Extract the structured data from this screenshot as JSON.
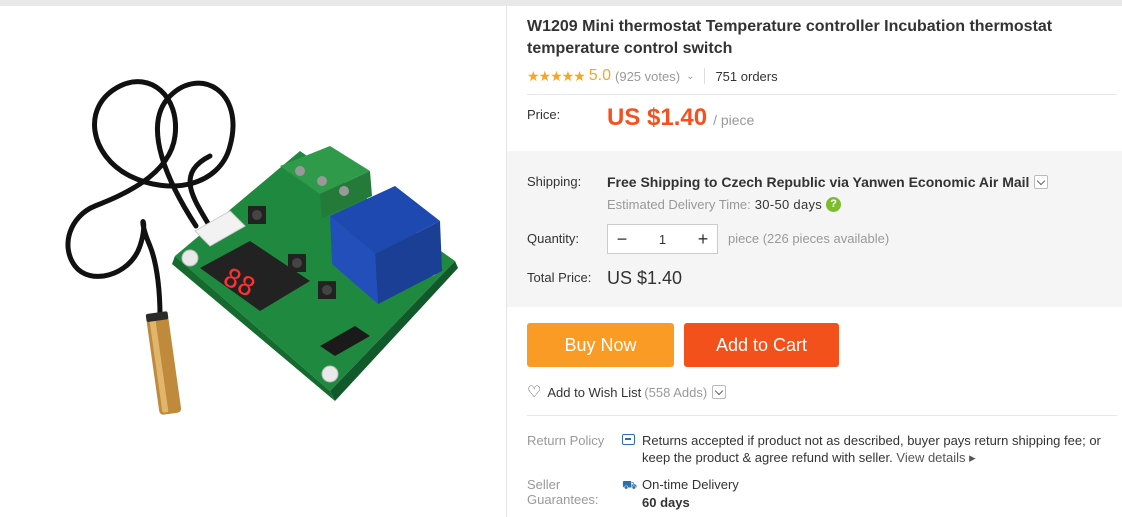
{
  "product": {
    "title": "W1209 Mini thermostat Temperature controller Incubation thermostat temperature control switch",
    "rating_stars": "★★★★★",
    "score": "5.0",
    "votes": "(925 votes)",
    "orders": "751 orders"
  },
  "price": {
    "label": "Price:",
    "value": "US $1.40",
    "unit": "/ piece"
  },
  "shipping": {
    "label": "Shipping:",
    "main": "Free Shipping to Czech Republic via Yanwen Economic Air Mail",
    "estimated_label": "Estimated Delivery Time:",
    "estimated_days": "30-50 days",
    "help_icon": "?"
  },
  "quantity": {
    "label": "Quantity:",
    "minus": "−",
    "value": "1",
    "plus": "+",
    "available": "piece (226 pieces available)"
  },
  "total": {
    "label": "Total Price:",
    "value": "US $1.40"
  },
  "actions": {
    "buy_now": "Buy Now",
    "add_to_cart": "Add to Cart"
  },
  "wishlist": {
    "label": "Add to Wish List",
    "count": "(558 Adds)"
  },
  "return_policy": {
    "label": "Return Policy",
    "text": "Returns accepted if product not as described, buyer pays return shipping fee; or keep the product & agree refund with seller.",
    "view_details": "View details ▸"
  },
  "seller_guarantees": {
    "label": "Seller Guarantees:",
    "ontime": "On-time Delivery",
    "days": "60 days"
  },
  "colors": {
    "price": "#f5511e",
    "buy_now": "#f99b24",
    "add_to_cart": "#f2511b",
    "star": "#f5a623",
    "help": "#7cbd2c"
  }
}
